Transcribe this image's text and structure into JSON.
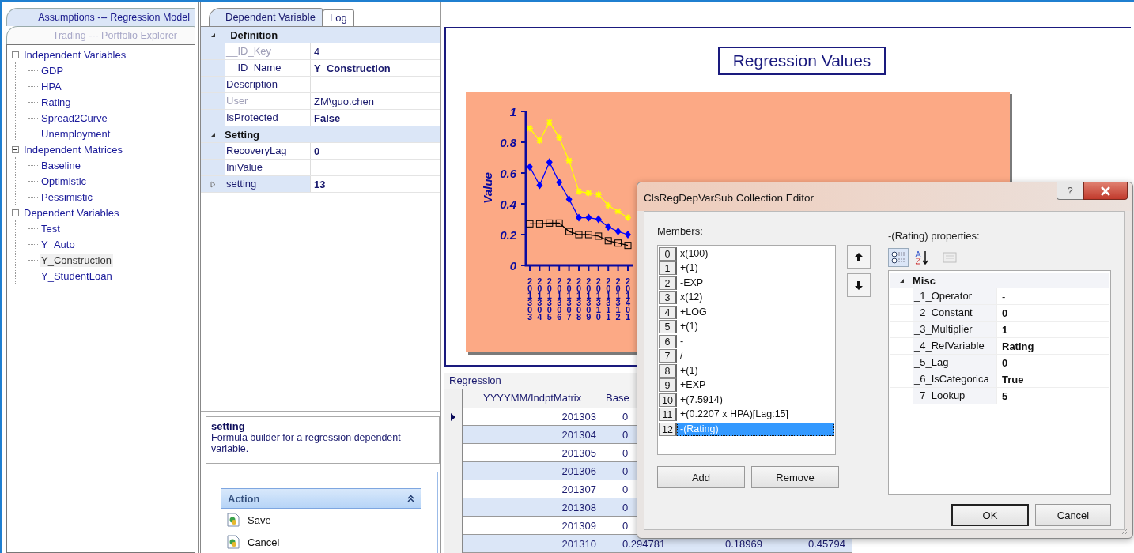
{
  "left_tabs": [
    {
      "label": "Assumptions --- Regression Model",
      "selected": true
    },
    {
      "label": "Trading --- Portfolio Explorer",
      "selected": false
    }
  ],
  "tree": [
    {
      "label": "Independent Variables",
      "expanded": true,
      "selected": false,
      "children": [
        {
          "label": "GDP",
          "selected": false
        },
        {
          "label": "HPA",
          "selected": false
        },
        {
          "label": "Rating",
          "selected": false
        },
        {
          "label": "Spread2Curve",
          "selected": false
        },
        {
          "label": "Unemployment",
          "selected": false
        }
      ]
    },
    {
      "label": "Independent Matrices",
      "expanded": true,
      "selected": false,
      "children": [
        {
          "label": "Baseline",
          "selected": false
        },
        {
          "label": "Optimistic",
          "selected": false
        },
        {
          "label": "Pessimistic",
          "selected": false
        }
      ]
    },
    {
      "label": "Dependent Variables",
      "expanded": true,
      "selected": false,
      "children": [
        {
          "label": "Test",
          "selected": false
        },
        {
          "label": "Y_Auto",
          "selected": false
        },
        {
          "label": "Y_Construction",
          "selected": true
        },
        {
          "label": "Y_StudentLoan",
          "selected": false
        }
      ]
    }
  ],
  "editor_tabs": [
    {
      "label": "Dependent Variable",
      "selected": true
    },
    {
      "label": "Log",
      "selected": false
    }
  ],
  "property_grid": [
    {
      "category": "_Definition",
      "expanded": true,
      "rows": [
        {
          "name": "__ID_Key",
          "value": "4",
          "readonly": true,
          "bold": false,
          "selected": false
        },
        {
          "name": "__ID_Name",
          "value": "Y_Construction",
          "readonly": false,
          "bold": true,
          "selected": false
        },
        {
          "name": "Description",
          "readonly": false,
          "selected": false
        },
        {
          "name": "User",
          "value": "ZM\\guo.chen",
          "readonly": true,
          "bold": false,
          "selected": false
        },
        {
          "name": "IsProtected",
          "value": "False",
          "readonly": false,
          "bold": true,
          "selected": false
        }
      ]
    },
    {
      "category": "Setting",
      "expanded": true,
      "rows": [
        {
          "name": "RecoveryLag",
          "value": "0",
          "readonly": false,
          "bold": true,
          "selected": false
        },
        {
          "name": "IniValue",
          "readonly": false,
          "selected": false
        },
        {
          "name": "setting",
          "value": "13",
          "readonly": false,
          "bold": true,
          "selected": true,
          "expanded": false
        }
      ]
    }
  ],
  "description": {
    "title": "setting",
    "text": "Formula builder for a regression dependent variable."
  },
  "action_panel": {
    "title": "Action",
    "expanded": true,
    "items": [
      "Save",
      "Cancel"
    ]
  },
  "chart": {
    "title": "Regression Values",
    "chart_data": {
      "type": "line",
      "ylabel": "Value",
      "categories": [
        "201303",
        "201304",
        "201305",
        "201306",
        "201307",
        "201308",
        "201309",
        "201310",
        "201311",
        "201312",
        "201401"
      ],
      "ylim": [
        0,
        1
      ],
      "yticks": [
        0,
        0.2,
        0.4,
        0.6,
        0.8,
        1
      ],
      "series": [
        {
          "marker": "cross",
          "color": "#ffff00",
          "values": [
            0.89,
            0.81,
            0.93,
            0.83,
            0.68,
            0.48,
            0.47,
            0.46,
            0.39,
            0.35,
            0.31
          ]
        },
        {
          "marker": "diamond",
          "color": "#0000ff",
          "values": [
            0.64,
            0.52,
            0.67,
            0.54,
            0.43,
            0.31,
            0.31,
            0.3,
            0.25,
            0.22,
            0.2
          ]
        },
        {
          "marker": "square",
          "color": "#000000",
          "values": [
            0.27,
            0.27,
            0.275,
            0.275,
            0.22,
            0.2,
            0.2,
            0.19,
            0.16,
            0.145,
            0.13
          ]
        }
      ]
    }
  },
  "grid": {
    "title": "Regression",
    "columns": [
      "YYYYMM/IndptMatrix",
      "Base"
    ],
    "rows": [
      {
        "current": true,
        "cells": [
          "201303",
          "0"
        ]
      },
      {
        "current": false,
        "cells": [
          "201304",
          "0"
        ]
      },
      {
        "current": false,
        "cells": [
          "201305",
          "0"
        ]
      },
      {
        "current": false,
        "cells": [
          "201306",
          "0"
        ]
      },
      {
        "current": false,
        "cells": [
          "201307",
          "0"
        ]
      },
      {
        "current": false,
        "cells": [
          "201308",
          "0"
        ]
      },
      {
        "current": false,
        "cells": [
          "201309",
          "0"
        ]
      },
      {
        "current": false,
        "cells": [
          "201310",
          "0.294781",
          "0.18969",
          "0.45794"
        ]
      }
    ]
  },
  "dialog": {
    "title": "ClsRegDepVarSub Collection Editor",
    "help": "?",
    "members_label": "Members:",
    "members": [
      {
        "index": "0",
        "label": "x(100)",
        "selected": false
      },
      {
        "index": "1",
        "label": "+(1)",
        "selected": false
      },
      {
        "index": "2",
        "label": "-EXP",
        "selected": false
      },
      {
        "index": "3",
        "label": "x(12)",
        "selected": false
      },
      {
        "index": "4",
        "label": "+LOG",
        "selected": false
      },
      {
        "index": "5",
        "label": "+(1)",
        "selected": false
      },
      {
        "index": "6",
        "label": "-",
        "selected": false
      },
      {
        "index": "7",
        "label": "/",
        "selected": false
      },
      {
        "index": "8",
        "label": "+(1)",
        "selected": false
      },
      {
        "index": "9",
        "label": "+EXP",
        "selected": false
      },
      {
        "index": "10",
        "label": "+(7.5914)",
        "selected": false
      },
      {
        "index": "11",
        "label": "+(0.2207 x HPA)[Lag:15]",
        "selected": false
      },
      {
        "index": "12",
        "label": "-(Rating)",
        "selected": true
      }
    ],
    "add": "Add",
    "remove": "Remove",
    "properties_label": "-(Rating) properties:",
    "category": "Misc",
    "category_expanded": true,
    "properties": [
      {
        "name": "_1_Operator",
        "value": "-",
        "bold": false
      },
      {
        "name": "_2_Constant",
        "value": "0",
        "bold": true
      },
      {
        "name": "_3_Multiplier",
        "value": "1",
        "bold": true
      },
      {
        "name": "_4_RefVariable",
        "value": "Rating",
        "bold": true
      },
      {
        "name": "_5_Lag",
        "value": "0",
        "bold": true
      },
      {
        "name": "_6_IsCategorica",
        "value": "True",
        "bold": true
      },
      {
        "name": "_7_Lookup",
        "value": "5",
        "bold": true
      }
    ],
    "ok": "OK",
    "cancel": "Cancel"
  }
}
